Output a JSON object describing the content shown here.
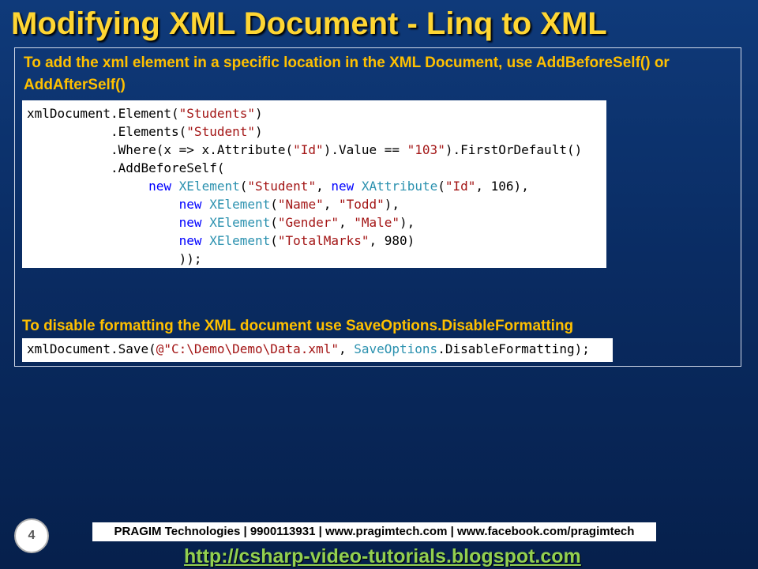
{
  "slide": {
    "title": "Modifying XML Document - Linq to XML",
    "bullet1": "To add the xml element in a specific location in the XML Document, use AddBeforeSelf() or AddAfterSelf()",
    "code1": [
      [
        {
          "t": "xmlDocument.Element("
        },
        {
          "t": "\"Students\"",
          "c": "s"
        },
        {
          "t": ")"
        }
      ],
      [
        {
          "t": "           .Elements("
        },
        {
          "t": "\"Student\"",
          "c": "s"
        },
        {
          "t": ")"
        }
      ],
      [
        {
          "t": "           .Where(x => x.Attribute("
        },
        {
          "t": "\"Id\"",
          "c": "s"
        },
        {
          "t": ").Value == "
        },
        {
          "t": "\"103\"",
          "c": "s"
        },
        {
          "t": ").FirstOrDefault()"
        }
      ],
      [
        {
          "t": "           .AddBeforeSelf("
        }
      ],
      [
        {
          "t": "                "
        },
        {
          "t": "new",
          "c": "k"
        },
        {
          "t": " "
        },
        {
          "t": "XElement",
          "c": "t"
        },
        {
          "t": "("
        },
        {
          "t": "\"Student\"",
          "c": "s"
        },
        {
          "t": ", "
        },
        {
          "t": "new",
          "c": "k"
        },
        {
          "t": " "
        },
        {
          "t": "XAttribute",
          "c": "t"
        },
        {
          "t": "("
        },
        {
          "t": "\"Id\"",
          "c": "s"
        },
        {
          "t": ", 106),"
        }
      ],
      [
        {
          "t": "                    "
        },
        {
          "t": "new",
          "c": "k"
        },
        {
          "t": " "
        },
        {
          "t": "XElement",
          "c": "t"
        },
        {
          "t": "("
        },
        {
          "t": "\"Name\"",
          "c": "s"
        },
        {
          "t": ", "
        },
        {
          "t": "\"Todd\"",
          "c": "s"
        },
        {
          "t": "),"
        }
      ],
      [
        {
          "t": "                    "
        },
        {
          "t": "new",
          "c": "k"
        },
        {
          "t": " "
        },
        {
          "t": "XElement",
          "c": "t"
        },
        {
          "t": "("
        },
        {
          "t": "\"Gender\"",
          "c": "s"
        },
        {
          "t": ", "
        },
        {
          "t": "\"Male\"",
          "c": "s"
        },
        {
          "t": "),"
        }
      ],
      [
        {
          "t": "                    "
        },
        {
          "t": "new",
          "c": "k"
        },
        {
          "t": " "
        },
        {
          "t": "XElement",
          "c": "t"
        },
        {
          "t": "("
        },
        {
          "t": "\"TotalMarks\"",
          "c": "s"
        },
        {
          "t": ", 980)"
        }
      ],
      [
        {
          "t": "                    ));"
        }
      ]
    ],
    "bullet2": "To disable formatting the XML document use SaveOptions.DisableFormatting",
    "code2": [
      [
        {
          "t": "xmlDocument.Save("
        },
        {
          "t": "@\"C:\\Demo\\Demo\\Data.xml\"",
          "c": "s"
        },
        {
          "t": ", "
        },
        {
          "t": "SaveOptions",
          "c": "t"
        },
        {
          "t": ".DisableFormatting);"
        }
      ]
    ]
  },
  "footer": {
    "page_number": "4",
    "company": "PRAGIM Technologies | 9900113931 | www.pragimtech.com | www.facebook.com/pragimtech",
    "url": "http://csharp-video-tutorials.blogspot.com"
  },
  "colors": {
    "title": "#ffd633",
    "bullet": "#ffc000",
    "link": "#92d050",
    "code_string": "#a31515",
    "code_type": "#2b91af",
    "code_keyword": "#0000ff"
  }
}
